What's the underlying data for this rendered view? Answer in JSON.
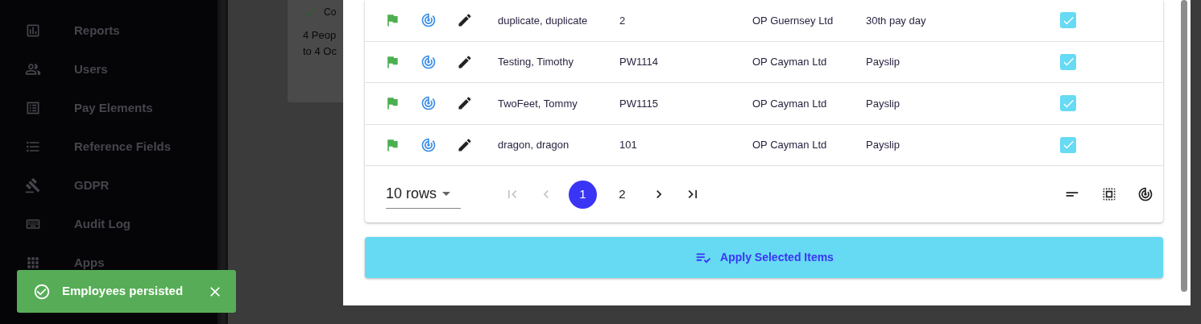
{
  "sidebar": {
    "items": [
      {
        "label": "Reports"
      },
      {
        "label": "Users"
      },
      {
        "label": "Pay Elements"
      },
      {
        "label": "Reference Fields"
      },
      {
        "label": "GDPR"
      },
      {
        "label": "Audit Log"
      },
      {
        "label": "Apps"
      }
    ]
  },
  "background_card": {
    "status": "Co",
    "lines": [
      "4 Peop",
      "to 4 Oc"
    ]
  },
  "table": {
    "rows": [
      {
        "name": "duplicate, duplicate",
        "code": "2",
        "company": "OP Guernsey Ltd",
        "schedule": "30th pay day",
        "checked": true
      },
      {
        "name": "Testing, Timothy",
        "code": "PW1114",
        "company": "OP Cayman Ltd",
        "schedule": "Payslip",
        "checked": true
      },
      {
        "name": "TwoFeet, Tommy",
        "code": "PW1115",
        "company": "OP Cayman Ltd",
        "schedule": "Payslip",
        "checked": true
      },
      {
        "name": "dragon, dragon",
        "code": "101",
        "company": "OP Cayman Ltd",
        "schedule": "Payslip",
        "checked": true
      }
    ],
    "rows_per_page": "10 rows",
    "pagination": {
      "first_disabled": true,
      "prev_disabled": true,
      "next_disabled": false,
      "last_disabled": false,
      "pages": [
        {
          "label": "1",
          "selected": true
        },
        {
          "label": "2",
          "selected": false
        }
      ]
    }
  },
  "apply_button": "Apply Selected Items",
  "toast": {
    "message": "Employees persisted"
  }
}
